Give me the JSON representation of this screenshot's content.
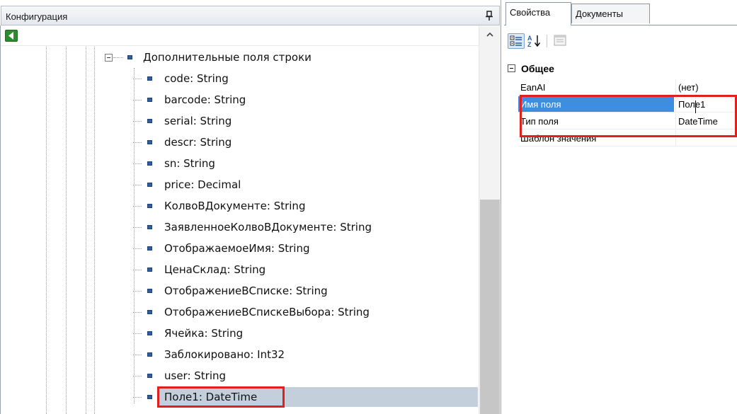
{
  "config_panel": {
    "title": "Конфигурация",
    "pin_icon": "pin-icon",
    "back_icon": "arrow-left-icon"
  },
  "tree": {
    "root_label": "Дополнительные поля строки",
    "items": [
      {
        "label": "code: String"
      },
      {
        "label": "barcode: String"
      },
      {
        "label": "serial: String"
      },
      {
        "label": "descr: String"
      },
      {
        "label": "sn: String"
      },
      {
        "label": "price: Decimal"
      },
      {
        "label": "КолвоВДокументе: String"
      },
      {
        "label": "ЗаявленноеКолвоВДокументе: String"
      },
      {
        "label": "ОтображаемоеИмя: String"
      },
      {
        "label": "ЦенаСклад: String"
      },
      {
        "label": "ОтображениеВСписке: String"
      },
      {
        "label": "ОтображениеВСпискеВыбора: String"
      },
      {
        "label": "Ячейка: String"
      },
      {
        "label": "Заблокировано: Int32"
      },
      {
        "label": "user: String"
      },
      {
        "label": "Поле1: DateTime"
      }
    ],
    "selected_index": 15
  },
  "props_panel": {
    "tabs": [
      {
        "label": "Свойства",
        "active": true
      },
      {
        "label": "Документы",
        "active": false
      }
    ],
    "toolbar": {
      "categorized_icon": "categorized-icon",
      "alphabetical_icon": "sort-az-icon",
      "pages_icon": "property-pages-icon"
    },
    "category": "Общее",
    "properties": [
      {
        "name": "EanAI",
        "value": "(нет)"
      },
      {
        "name": "Имя поля",
        "value": "Поле1"
      },
      {
        "name": "Тип поля",
        "value": "DateTime"
      },
      {
        "name": "Шаблон значения",
        "value": ""
      }
    ]
  },
  "colors": {
    "selection_highlight": "#c3cfdb",
    "property_selection": "#3d8ee0",
    "annotation_red": "#e02020",
    "tree_bullet": "#2f5fa3"
  }
}
